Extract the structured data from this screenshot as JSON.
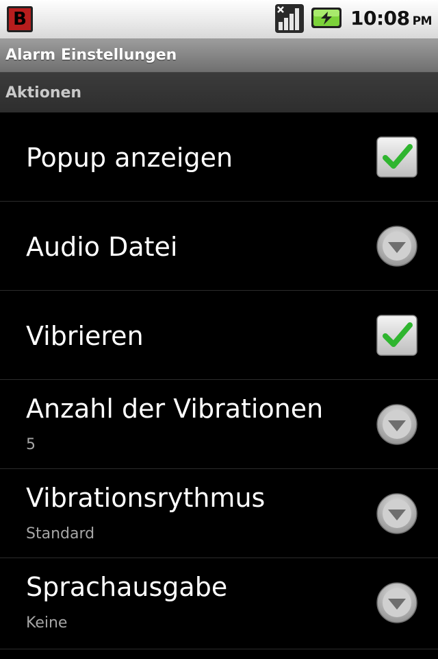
{
  "status_bar": {
    "app_badge_letter": "B",
    "time": "10:08",
    "ampm": "PM",
    "icons": [
      "app-badge-icon",
      "signal-icon",
      "battery-charging-icon"
    ]
  },
  "title_bar": {
    "title": "Alarm Einstellungen"
  },
  "category": {
    "label": "Aktionen"
  },
  "preferences": [
    {
      "title": "Popup anzeigen",
      "summary": "",
      "widget": "checkbox",
      "checked": true
    },
    {
      "title": "Audio Datei",
      "summary": "",
      "widget": "dropdown-arrow",
      "checked": null
    },
    {
      "title": "Vibrieren",
      "summary": "",
      "widget": "checkbox",
      "checked": true
    },
    {
      "title": "Anzahl der Vibrationen",
      "summary": "5",
      "widget": "dropdown-arrow",
      "checked": null
    },
    {
      "title": "Vibrationsrythmus",
      "summary": "Standard",
      "widget": "dropdown-arrow",
      "checked": null
    },
    {
      "title": "Sprachausgabe",
      "summary": "Keine",
      "widget": "dropdown-arrow",
      "checked": null
    }
  ],
  "colors": {
    "background": "#000000",
    "checkmark": "#2fb52f",
    "summary_text": "#a6a6a6"
  }
}
